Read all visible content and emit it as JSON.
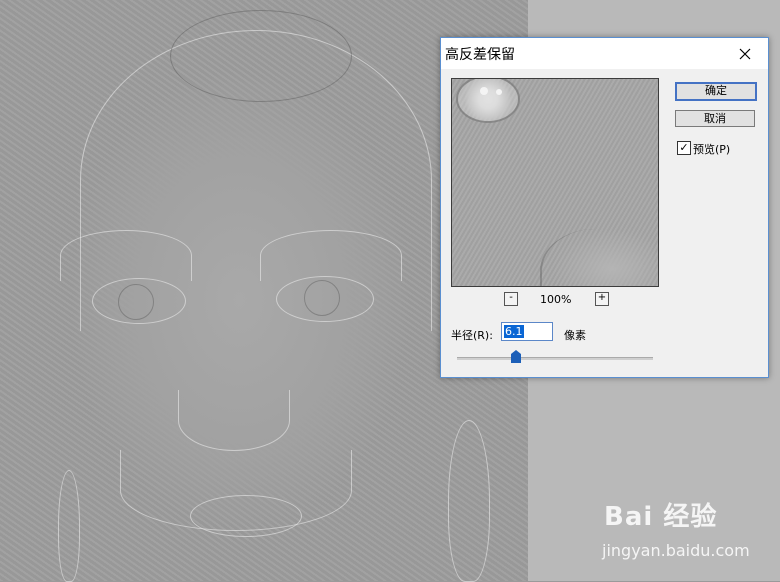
{
  "dialog": {
    "title": "高反差保留",
    "ok_label": "确定",
    "cancel_label": "取消",
    "preview_checkbox": {
      "label": "预览(P)",
      "checked": true,
      "mark": "✓"
    },
    "zoom": {
      "level": "100%",
      "minus": "-",
      "plus": "+"
    },
    "radius": {
      "label": "半径(R):",
      "value": "6.1",
      "unit": "像素"
    }
  },
  "icons": [
    "close-icon",
    "minus-icon",
    "plus-icon",
    "slider-thumb-icon"
  ],
  "watermark": {
    "logo": "Bai 经验",
    "url": "jingyan.baidu.com"
  },
  "colors": {
    "accent": "#0a66d4",
    "dialog_border": "#5a8fd0",
    "canvas_gray": "#9d9d9d"
  }
}
